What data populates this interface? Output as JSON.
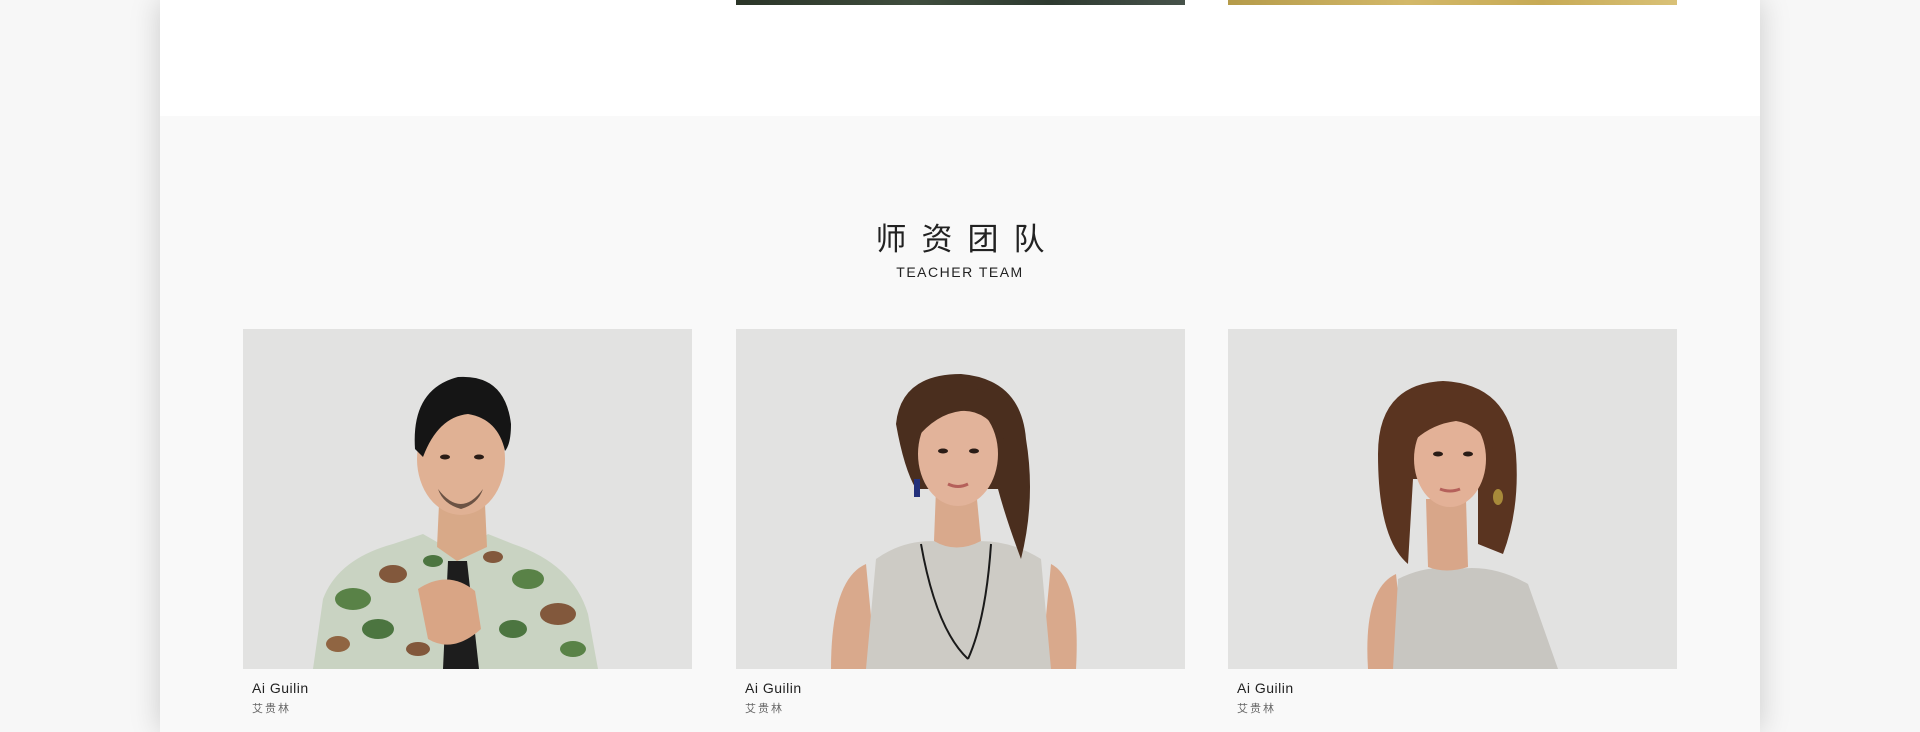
{
  "section": {
    "title_cn": "师资团队",
    "title_en": "TEACHER TEAM"
  },
  "teachers": [
    {
      "name_en": "Ai Guilin",
      "name_cn": "艾贵林"
    },
    {
      "name_en": "Ai Guilin",
      "name_cn": "艾贵林"
    },
    {
      "name_en": "Ai Guilin",
      "name_cn": "艾贵林"
    }
  ],
  "colors": {
    "page_bg": "#ffffff",
    "section_bg": "#f9f9f9",
    "photo_bg": "#e3e3e2",
    "text_dark": "#222222",
    "text_muted": "#666666"
  }
}
